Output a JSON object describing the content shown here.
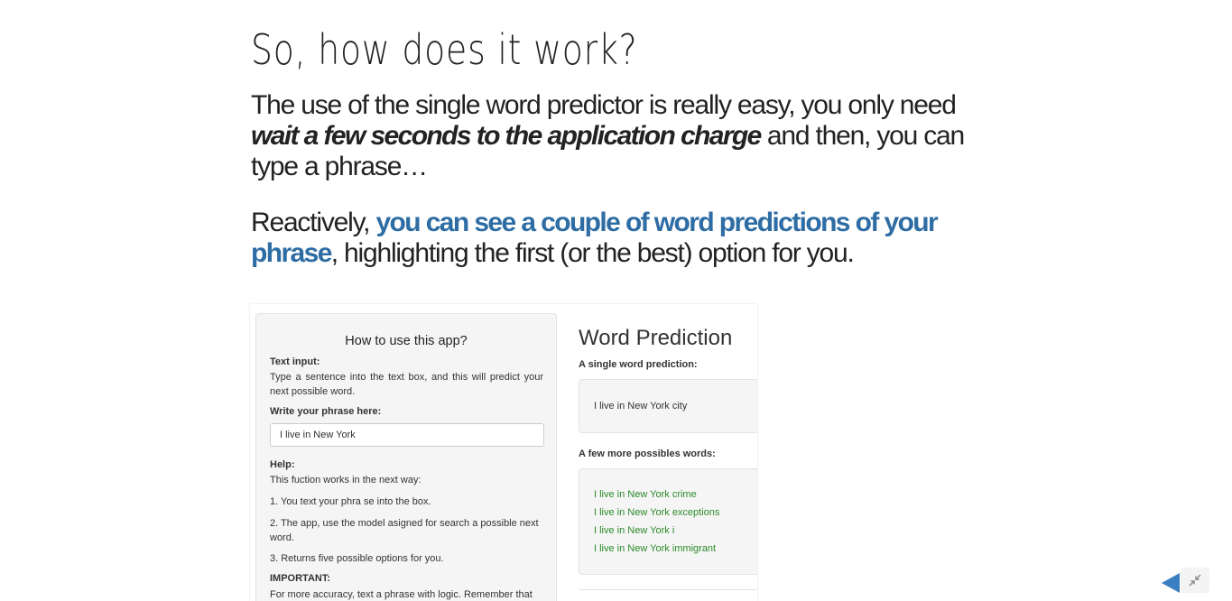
{
  "slide": {
    "title": "So, how does it work?",
    "p1_a": "The use of the single word predictor is really easy, you only need ",
    "p1_em": "wait a few seconds to the application charge",
    "p1_b": " and then, you can type a phrase…",
    "p2_a": "Reactively, ",
    "p2_hl": "you can see a couple of word predictions of your phrase",
    "p2_b": ", highlighting the first (or the best) option for you."
  },
  "app": {
    "sidebar": {
      "heading": "How to use this app?",
      "text_input_label": "Text input:",
      "text_input_desc": "Type a sentence into the text box, and this will predict your next possible word.",
      "phrase_label": "Write your phrase here:",
      "phrase_value": "I live in New York",
      "help_label": "Help:",
      "help_intro": "This fuction works in the next way:",
      "step1": "1. You text your phra se into the box.",
      "step2": "2. The app, use the model asigned for search a possible next word.",
      "step3": "3. Returns five possible options for you.",
      "important_label": "IMPORTANT:",
      "important_text": "For more accuracy, text a phrase with logic. Remember that"
    },
    "main": {
      "title": "Word Prediction",
      "single_label": "A single word prediction:",
      "single_value": "I live in New York city",
      "more_label": "A few more possibles words:",
      "more_values": [
        "I live in New York crime",
        "I live in New York exceptions",
        "I live in New York i",
        "I live in New York immigrant"
      ]
    }
  },
  "colors": {
    "highlight": "#2e6da4",
    "prediction_green": "#2a8a2a",
    "nav_arrow": "#3a7fc1"
  },
  "icons": {
    "prev": "left-triangle-icon",
    "shrink": "collapse-arrows-icon"
  }
}
